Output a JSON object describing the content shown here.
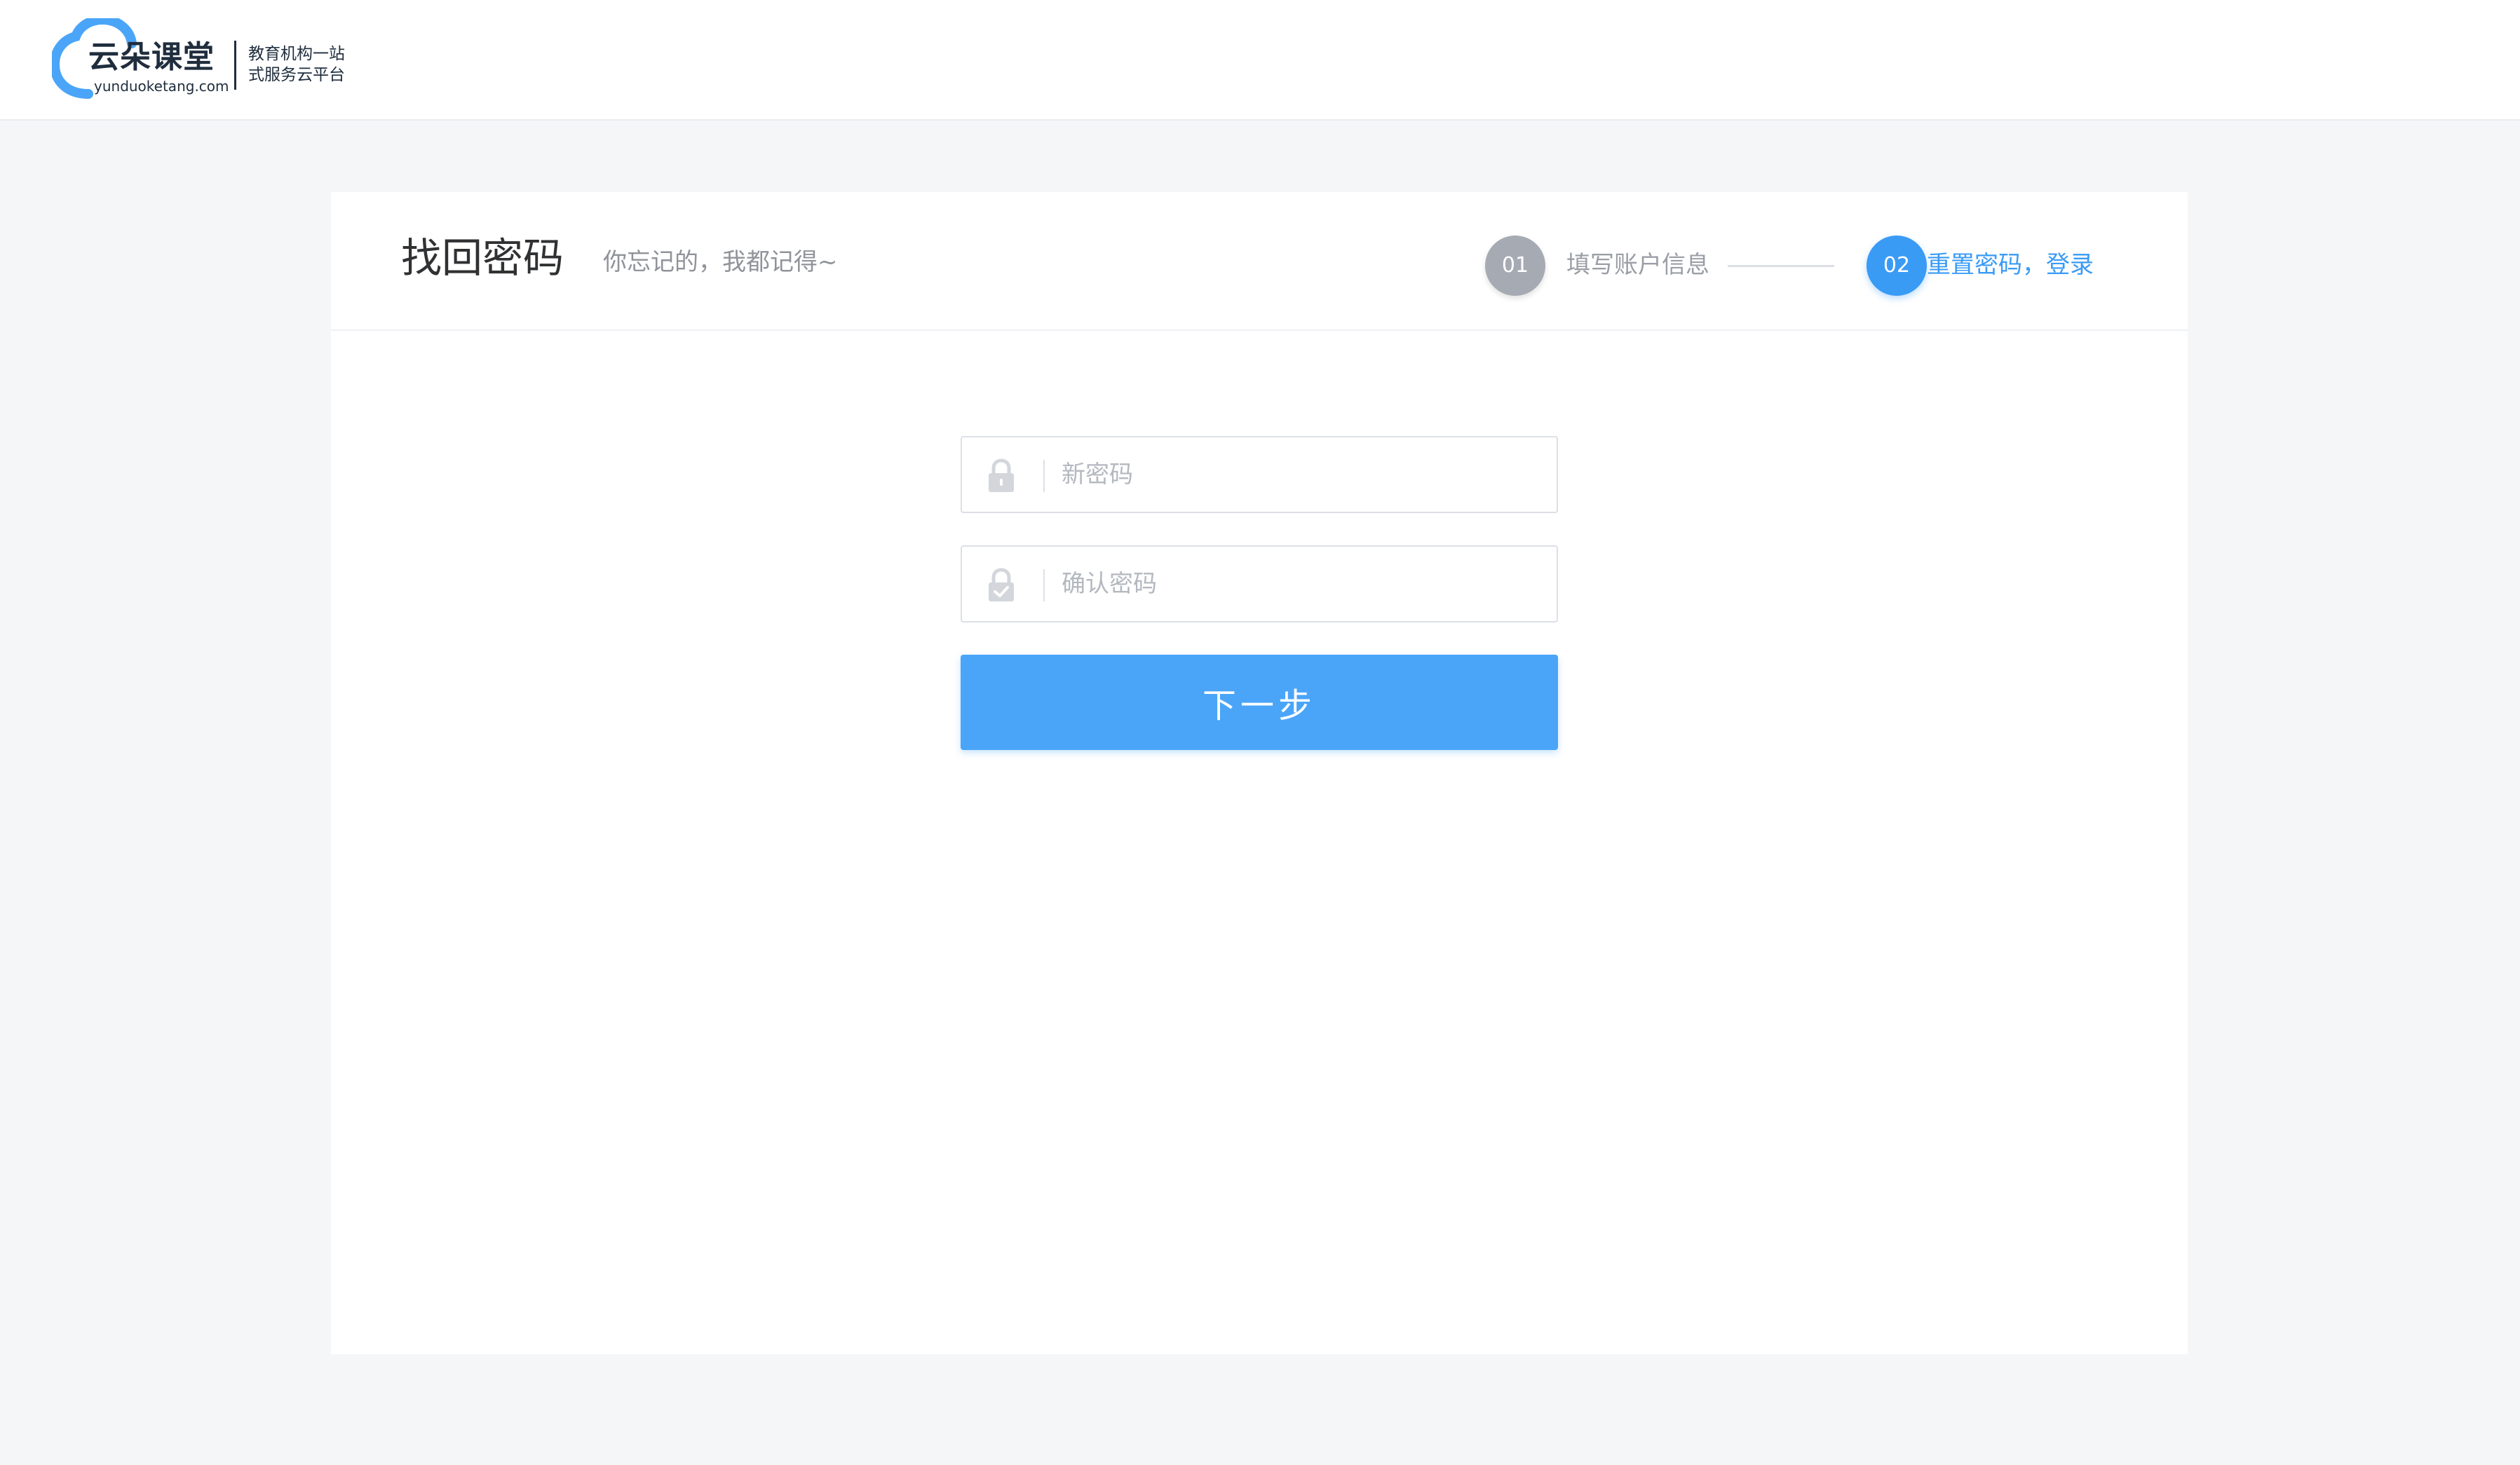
{
  "header": {
    "logo": {
      "title": "云朵课堂",
      "domain": "yunduoketang.com",
      "slogan_line1": "教育机构一站",
      "slogan_line2": "式服务云平台"
    }
  },
  "card": {
    "title": "找回密码",
    "subtitle": "你忘记的，我都记得~",
    "steps": [
      {
        "number": "01",
        "label": "填写账户信息",
        "state": "done"
      },
      {
        "number": "02",
        "label": "重置密码，登录",
        "state": "active"
      }
    ],
    "form": {
      "new_password": {
        "placeholder": "新密码",
        "icon": "lock-icon"
      },
      "confirm_password": {
        "placeholder": "确认密码",
        "icon": "lock-check-icon"
      },
      "submit_label": "下一步"
    }
  },
  "colors": {
    "accent": "#4aa5f8",
    "step_active": "#3a9bf5",
    "step_done": "#a6abb3",
    "logo_blue": "#4aa5f8",
    "page_background": "#f5f6f8"
  }
}
